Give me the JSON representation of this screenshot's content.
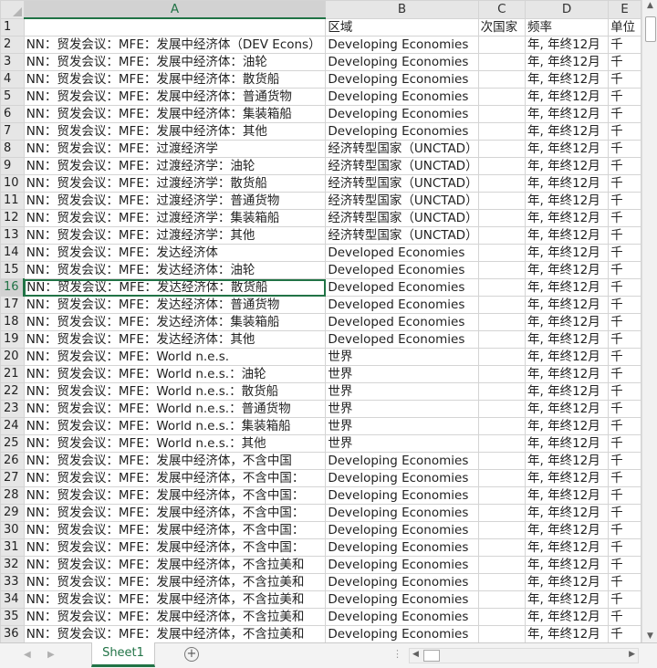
{
  "columns": [
    "A",
    "B",
    "C",
    "D",
    "E"
  ],
  "active_column": "A",
  "active_row": 16,
  "rows": [
    {
      "n": "1",
      "a": "",
      "b": "区域",
      "c": "次国家",
      "d": "频率",
      "e": "单位"
    },
    {
      "n": "2",
      "a": "NN：贸发会议：MFE：发展中经济体（DEV Econs）",
      "b": "Developing Economies",
      "c": "",
      "d": "年, 年终12月",
      "e": "千"
    },
    {
      "n": "3",
      "a": "NN：贸发会议：MFE：发展中经济体：油轮",
      "b": "Developing Economies",
      "c": "",
      "d": "年, 年终12月",
      "e": "千"
    },
    {
      "n": "4",
      "a": "NN：贸发会议：MFE：发展中经济体：散货船",
      "b": "Developing Economies",
      "c": "",
      "d": "年, 年终12月",
      "e": "千"
    },
    {
      "n": "5",
      "a": "NN：贸发会议：MFE：发展中经济体：普通货物",
      "b": "Developing Economies",
      "c": "",
      "d": "年, 年终12月",
      "e": "千"
    },
    {
      "n": "6",
      "a": "NN：贸发会议：MFE：发展中经济体：集装箱船",
      "b": "Developing Economies",
      "c": "",
      "d": "年, 年终12月",
      "e": "千"
    },
    {
      "n": "7",
      "a": "NN：贸发会议：MFE：发展中经济体：其他",
      "b": "Developing Economies",
      "c": "",
      "d": "年, 年终12月",
      "e": "千"
    },
    {
      "n": "8",
      "a": "NN：贸发会议：MFE：过渡经济学",
      "b": "经济转型国家（UNCTAD）",
      "c": "",
      "d": "年, 年终12月",
      "e": "千"
    },
    {
      "n": "9",
      "a": "NN：贸发会议：MFE：过渡经济学：油轮",
      "b": "经济转型国家（UNCTAD）",
      "c": "",
      "d": "年, 年终12月",
      "e": "千"
    },
    {
      "n": "10",
      "a": "NN：贸发会议：MFE：过渡经济学：散货船",
      "b": "经济转型国家（UNCTAD）",
      "c": "",
      "d": "年, 年终12月",
      "e": "千"
    },
    {
      "n": "11",
      "a": "NN：贸发会议：MFE：过渡经济学：普通货物",
      "b": "经济转型国家（UNCTAD）",
      "c": "",
      "d": "年, 年终12月",
      "e": "千"
    },
    {
      "n": "12",
      "a": "NN：贸发会议：MFE：过渡经济学：集装箱船",
      "b": "经济转型国家（UNCTAD）",
      "c": "",
      "d": "年, 年终12月",
      "e": "千"
    },
    {
      "n": "13",
      "a": "NN：贸发会议：MFE：过渡经济学：其他",
      "b": "经济转型国家（UNCTAD）",
      "c": "",
      "d": "年, 年终12月",
      "e": "千"
    },
    {
      "n": "14",
      "a": "NN：贸发会议：MFE：发达经济体",
      "b": "Developed Economies",
      "c": "",
      "d": "年, 年终12月",
      "e": "千"
    },
    {
      "n": "15",
      "a": "NN：贸发会议：MFE：发达经济体：油轮",
      "b": "Developed Economies",
      "c": "",
      "d": "年, 年终12月",
      "e": "千"
    },
    {
      "n": "16",
      "a": "NN：贸发会议：MFE：发达经济体：散货船",
      "b": "Developed Economies",
      "c": "",
      "d": "年, 年终12月",
      "e": "千"
    },
    {
      "n": "17",
      "a": "NN：贸发会议：MFE：发达经济体：普通货物",
      "b": "Developed Economies",
      "c": "",
      "d": "年, 年终12月",
      "e": "千"
    },
    {
      "n": "18",
      "a": "NN：贸发会议：MFE：发达经济体：集装箱船",
      "b": "Developed Economies",
      "c": "",
      "d": "年, 年终12月",
      "e": "千"
    },
    {
      "n": "19",
      "a": "NN：贸发会议：MFE：发达经济体：其他",
      "b": "Developed Economies",
      "c": "",
      "d": "年, 年终12月",
      "e": "千"
    },
    {
      "n": "20",
      "a": "NN：贸发会议：MFE：World n.e.s.",
      "b": "世界",
      "c": "",
      "d": "年, 年终12月",
      "e": "千"
    },
    {
      "n": "21",
      "a": "NN：贸发会议：MFE：World n.e.s.：油轮",
      "b": "世界",
      "c": "",
      "d": "年, 年终12月",
      "e": "千"
    },
    {
      "n": "22",
      "a": "NN：贸发会议：MFE：World n.e.s.：散货船",
      "b": "世界",
      "c": "",
      "d": "年, 年终12月",
      "e": "千"
    },
    {
      "n": "23",
      "a": "NN：贸发会议：MFE：World n.e.s.：普通货物",
      "b": "世界",
      "c": "",
      "d": "年, 年终12月",
      "e": "千"
    },
    {
      "n": "24",
      "a": "NN：贸发会议：MFE：World n.e.s.：集装箱船",
      "b": "世界",
      "c": "",
      "d": "年, 年终12月",
      "e": "千"
    },
    {
      "n": "25",
      "a": "NN：贸发会议：MFE：World n.e.s.：其他",
      "b": "世界",
      "c": "",
      "d": "年, 年终12月",
      "e": "千"
    },
    {
      "n": "26",
      "a": "NN：贸发会议：MFE：发展中经济体，不含中国",
      "b": "Developing Economies",
      "c": "",
      "d": "年, 年终12月",
      "e": "千"
    },
    {
      "n": "27",
      "a": "NN：贸发会议：MFE：发展中经济体，不含中国：",
      "b": "Developing Economies",
      "c": "",
      "d": "年, 年终12月",
      "e": "千"
    },
    {
      "n": "28",
      "a": "NN：贸发会议：MFE：发展中经济体，不含中国：",
      "b": "Developing Economies",
      "c": "",
      "d": "年, 年终12月",
      "e": "千"
    },
    {
      "n": "29",
      "a": "NN：贸发会议：MFE：发展中经济体，不含中国：",
      "b": "Developing Economies",
      "c": "",
      "d": "年, 年终12月",
      "e": "千"
    },
    {
      "n": "30",
      "a": "NN：贸发会议：MFE：发展中经济体，不含中国：",
      "b": "Developing Economies",
      "c": "",
      "d": "年, 年终12月",
      "e": "千"
    },
    {
      "n": "31",
      "a": "NN：贸发会议：MFE：发展中经济体，不含中国：",
      "b": "Developing Economies",
      "c": "",
      "d": "年, 年终12月",
      "e": "千"
    },
    {
      "n": "32",
      "a": "NN：贸发会议：MFE：发展中经济体，不含拉美和",
      "b": "Developing Economies",
      "c": "",
      "d": "年, 年终12月",
      "e": "千"
    },
    {
      "n": "33",
      "a": "NN：贸发会议：MFE：发展中经济体，不含拉美和",
      "b": "Developing Economies",
      "c": "",
      "d": "年, 年终12月",
      "e": "千"
    },
    {
      "n": "34",
      "a": "NN：贸发会议：MFE：发展中经济体，不含拉美和",
      "b": "Developing Economies",
      "c": "",
      "d": "年, 年终12月",
      "e": "千"
    },
    {
      "n": "35",
      "a": "NN：贸发会议：MFE：发展中经济体，不含拉美和",
      "b": "Developing Economies",
      "c": "",
      "d": "年, 年终12月",
      "e": "千"
    },
    {
      "n": "36",
      "a": "NN：贸发会议：MFE：发展中经济体，不含拉美和",
      "b": "Developing Economies",
      "c": "",
      "d": "年, 年终12月",
      "e": "千"
    }
  ],
  "sheet_tab": "Sheet1",
  "add_sheet_symbol": "+",
  "tab_dots": "⋮",
  "icons": {
    "scroll_up": "▲",
    "scroll_down": "▼",
    "scroll_left": "◀",
    "scroll_right": "▶",
    "nav_prev": "◀",
    "nav_next": "▶"
  },
  "colors": {
    "accent": "#217346",
    "header_bg": "#e6e6e6",
    "gridline": "#d4d4d4"
  }
}
